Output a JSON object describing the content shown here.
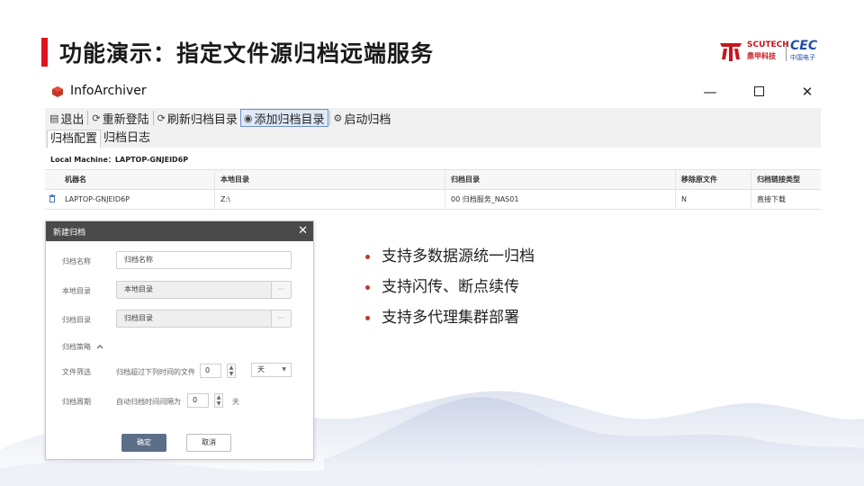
{
  "slide": {
    "title": "功能演示：指定文件源归档远端服务",
    "logo": {
      "brand_en": "SCUTECH",
      "brand_cn": "鼎甲科技",
      "partner_en": "CEC",
      "partner_cn": "中国电子"
    },
    "bullets": [
      "支持多数据源统一归档",
      "支持闪传、断点续传",
      "支持多代理集群部署"
    ],
    "colors": {
      "accent": "#e0141e",
      "cec_blue": "#1d4fa6"
    }
  },
  "window": {
    "title": "InfoArchiver",
    "controls": {
      "minimize": "—",
      "close": "✕"
    },
    "toolbar": [
      {
        "label": "退出",
        "icon": "exit-icon",
        "glyph": "▤",
        "active": false
      },
      {
        "label": "重新登陆",
        "icon": "refresh-icon",
        "glyph": "⟳",
        "active": false
      },
      {
        "label": "刷新归档目录",
        "icon": "refresh-icon",
        "glyph": "⟳",
        "active": false
      },
      {
        "label": "添加归档目录",
        "icon": "add-folder-icon",
        "glyph": "◉",
        "active": true
      },
      {
        "label": "启动归档",
        "icon": "start-icon",
        "glyph": "⚙",
        "active": false
      }
    ],
    "tabs": [
      {
        "label": "归档配置",
        "active": true
      },
      {
        "label": "归档日志",
        "active": false
      }
    ],
    "machine_label": "Local Machine：LAPTOP-GNJEID6P",
    "table": {
      "headers": [
        "机器名",
        "本地目录",
        "归档目录",
        "移除原文件",
        "归档链接类型"
      ],
      "rows": [
        [
          "LAPTOP-GNJEID6P",
          "Z:\\",
          "00 归档服务_NAS01",
          "N",
          "直接下载"
        ]
      ]
    }
  },
  "dialog": {
    "title": "新建归档",
    "close": "✕",
    "fields": {
      "name_label": "归档名称",
      "name_placeholder": "归档名称",
      "local_label": "本地目录",
      "local_placeholder": "本地目录",
      "archive_label": "归档目录",
      "archive_placeholder": "归档目录",
      "browse": "···"
    },
    "strategy_label": "归档策略",
    "filter": {
      "label": "文件筛选",
      "text": "归档超过下列时间的文件",
      "value": "0",
      "unit": "天"
    },
    "period": {
      "label": "归档周期",
      "text": "自动归档时间间隔为",
      "value": "0",
      "unit": "天"
    },
    "ok_label": "确定",
    "cancel_label": "取消"
  }
}
